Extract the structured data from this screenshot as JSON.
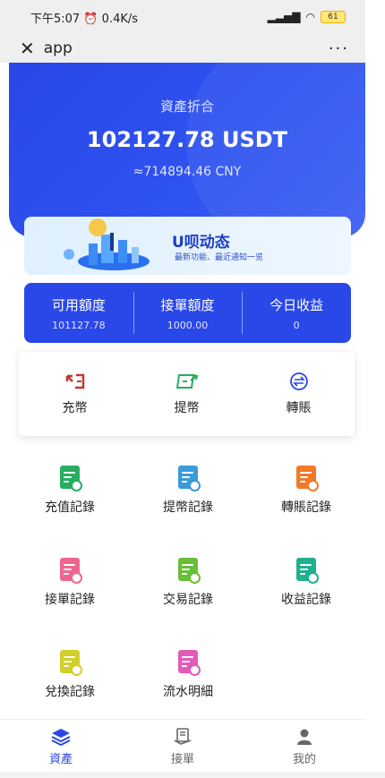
{
  "status_bar": {
    "time": "下午5:07",
    "net_speed": "0.4K/s",
    "signal": "4G",
    "battery": "61"
  },
  "nav": {
    "title": "app",
    "more": "···"
  },
  "hero": {
    "label": "資產折合",
    "total": "102127.78 USDT",
    "cny": "≈714894.46 CNY"
  },
  "banner": {
    "title": "U呗动态",
    "subtitle": "最新功能、最近通知一览"
  },
  "stats": [
    {
      "label": "可用額度",
      "value": "101127.78"
    },
    {
      "label": "接單額度",
      "value": "1000.00"
    },
    {
      "label": "今日收益",
      "value": "0"
    }
  ],
  "quick_actions": [
    {
      "label": "充幣",
      "icon": "deposit-icon"
    },
    {
      "label": "提幣",
      "icon": "withdraw-icon"
    },
    {
      "label": "轉賬",
      "icon": "transfer-icon"
    }
  ],
  "records": [
    {
      "label": "充值記錄",
      "icon": "deposit-record-icon",
      "color": "#27ae60"
    },
    {
      "label": "提幣記錄",
      "icon": "withdraw-record-icon",
      "color": "#3b9ad9"
    },
    {
      "label": "轉賬記錄",
      "icon": "transfer-record-icon",
      "color": "#f07a2a"
    },
    {
      "label": "接單記錄",
      "icon": "order-record-icon",
      "color": "#ee6690"
    },
    {
      "label": "交易記錄",
      "icon": "trade-record-icon",
      "color": "#67bf36"
    },
    {
      "label": "收益記錄",
      "icon": "income-record-icon",
      "color": "#1fb08f"
    },
    {
      "label": "兌換記錄",
      "icon": "exchange-record-icon",
      "color": "#d2cf2a"
    },
    {
      "label": "流水明細",
      "icon": "flow-detail-icon",
      "color": "#e25bb8"
    }
  ],
  "tabs": [
    {
      "label": "資產",
      "icon": "assets-icon",
      "active": true
    },
    {
      "label": "接單",
      "icon": "orders-icon",
      "active": false
    },
    {
      "label": "我的",
      "icon": "profile-icon",
      "active": false
    }
  ],
  "colors": {
    "primary": "#2a47e8",
    "deposit_red": "#c0392b",
    "withdraw_green": "#27ae60",
    "transfer_blue": "#2a47e8"
  }
}
